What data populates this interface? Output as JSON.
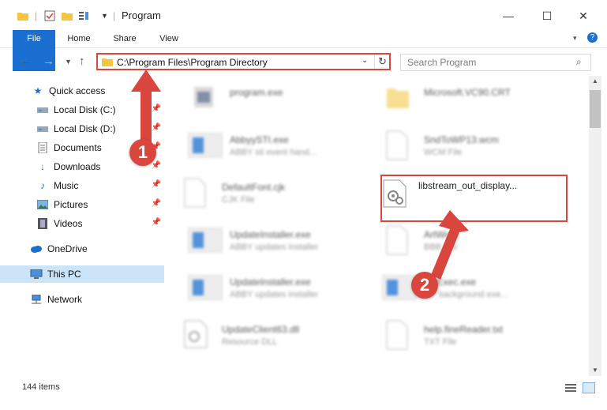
{
  "window": {
    "title": "Program",
    "controls": {
      "minimize": "—",
      "maximize": "☐",
      "close": "✕"
    }
  },
  "ribbon": {
    "tabs": [
      {
        "label": "File"
      },
      {
        "label": "Home"
      },
      {
        "label": "Share"
      },
      {
        "label": "View"
      }
    ]
  },
  "address_bar": {
    "path": "C:\\Program Files\\Program Directory"
  },
  "search": {
    "placeholder": "Search Program"
  },
  "nav_pane": {
    "items": [
      {
        "label": "Quick access",
        "icon": "star-icon",
        "pinned": false
      },
      {
        "label": "Local Disk (C:)",
        "icon": "drive-icon",
        "pinned": true
      },
      {
        "label": "Local Disk (D:)",
        "icon": "drive-icon",
        "pinned": true
      },
      {
        "label": "Documents",
        "icon": "documents-icon",
        "pinned": true
      },
      {
        "label": "Downloads",
        "icon": "download-icon",
        "pinned": true
      },
      {
        "label": "Music",
        "icon": "music-icon",
        "pinned": true
      },
      {
        "label": "Pictures",
        "icon": "pictures-icon",
        "pinned": true
      },
      {
        "label": "Videos",
        "icon": "videos-icon",
        "pinned": true
      },
      {
        "label": "OneDrive",
        "icon": "cloud-icon",
        "pinned": false
      },
      {
        "label": "This PC",
        "icon": "computer-icon",
        "pinned": false,
        "selected": true
      },
      {
        "label": "Network",
        "icon": "network-icon",
        "pinned": false
      }
    ]
  },
  "files": [
    {
      "name": "program.exe",
      "type": "",
      "icon": "exe-icon",
      "blurred": true
    },
    {
      "name": "Microsoft.VC90.CRT",
      "type": "",
      "icon": "folder-icon",
      "blurred": true
    },
    {
      "name": "AbbyySTI.exe",
      "type": "ABBY sti event hand...",
      "icon": "exe-icon",
      "blurred": true
    },
    {
      "name": "SndToWP13.wcm",
      "type": "WCM File",
      "icon": "file-icon",
      "blurred": true
    },
    {
      "name": "DefaultFont.cjk",
      "type": "CJK File",
      "icon": "file-icon",
      "blurred": true
    },
    {
      "name": "libstream_out_display...",
      "type": "",
      "icon": "dll-icon",
      "blurred": false
    },
    {
      "name": "UpdateInstaller.exe",
      "type": "ABBY updates installer",
      "icon": "exe-icon",
      "blurred": true
    },
    {
      "name": "ArtWord",
      "type": "BBB File",
      "icon": "file-icon",
      "blurred": true
    },
    {
      "name": "UpdateInstaller.exe",
      "type": "ABBY updates installer",
      "icon": "exe-icon",
      "blurred": true
    },
    {
      "name": "...eExec.exe",
      "type": "...F background exe...",
      "icon": "exe-icon",
      "blurred": true
    },
    {
      "name": "UpdateClient63.dll",
      "type": "Resource DLL",
      "icon": "dll-icon",
      "blurred": true
    },
    {
      "name": "help.fineReader.txt",
      "type": "TXT File",
      "icon": "file-icon",
      "blurred": true
    }
  ],
  "status": {
    "item_count": "144 items"
  },
  "annotations": {
    "step1": "1",
    "step2": "2",
    "accent": "#d9463d"
  }
}
